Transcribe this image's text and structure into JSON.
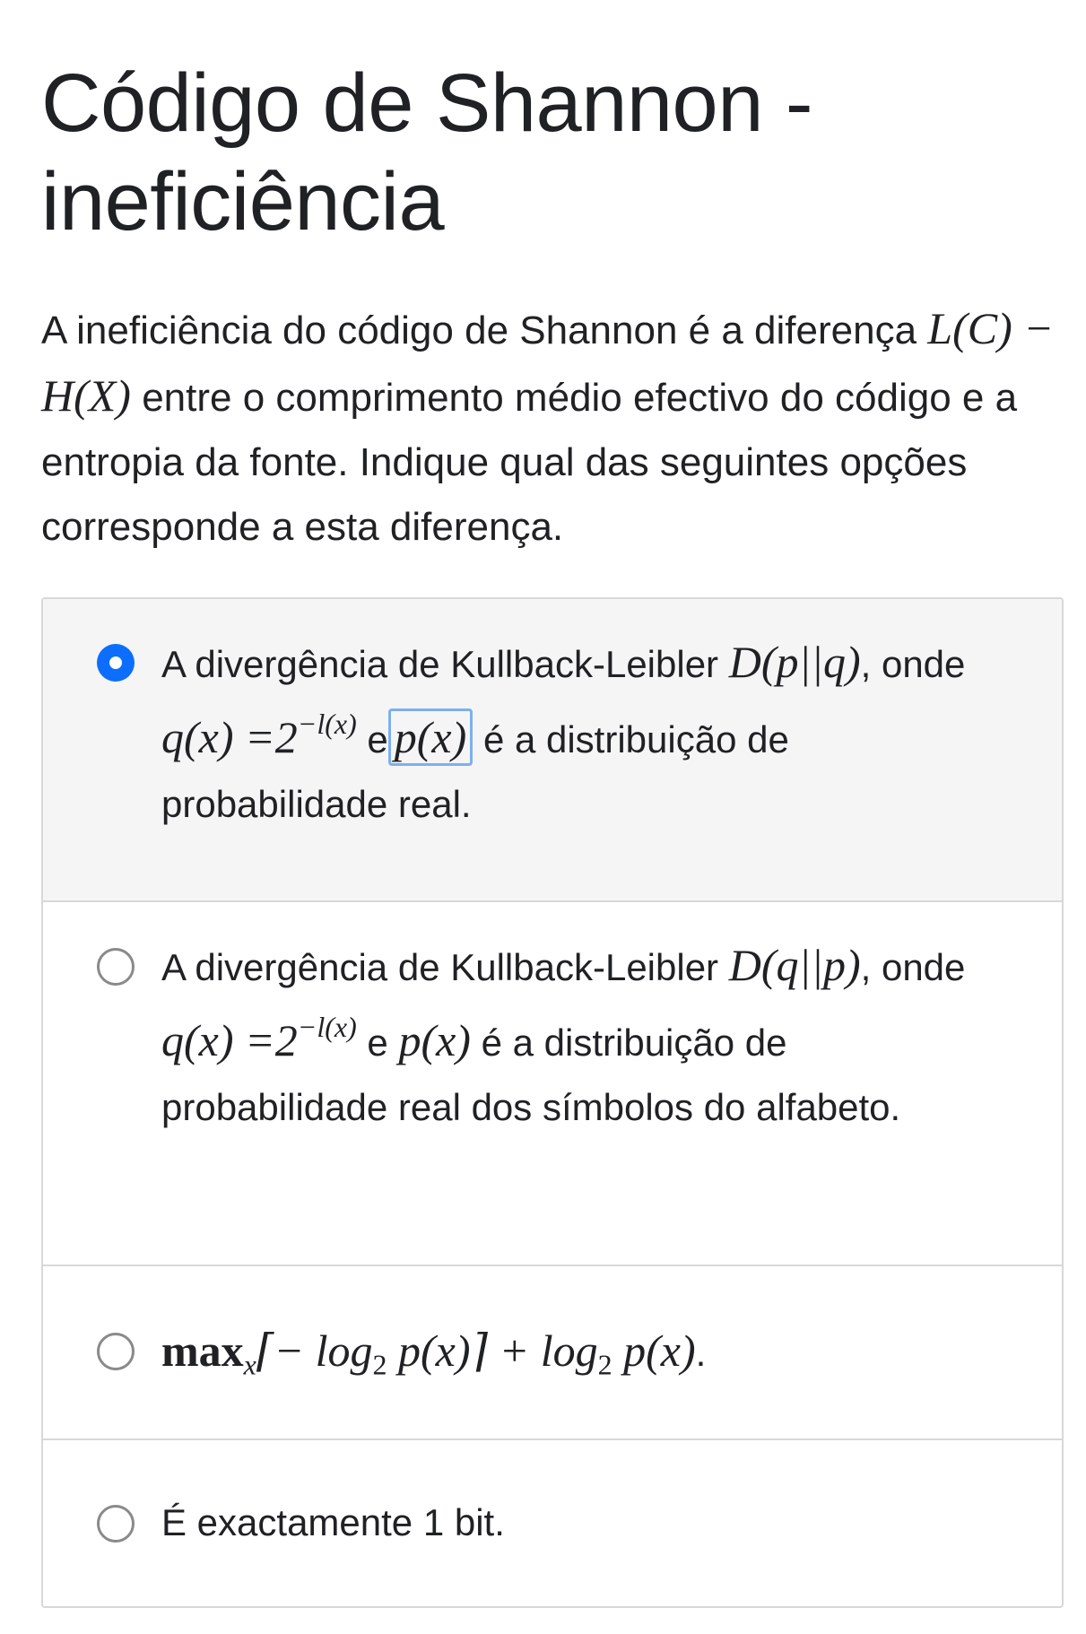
{
  "title": "Código de Shannon - ineficiência",
  "question": {
    "text_before": "A ineficiência do código de Shannon é a diferença",
    "math": "L(C) − H(X)",
    "text_after": "entre o comprimento médio efectivo do código e a entropia da fonte. Indique qual das seguintes opções corresponde a esta diferença."
  },
  "options": [
    {
      "selected": true,
      "text_a": "A divergência de Kullback-Leibler",
      "math_a": "D(p||q)",
      "text_b": ", onde",
      "math_b": "q(x) =2",
      "math_b_sup": "−l(x)",
      "text_c": "e",
      "math_c": "p(x)",
      "text_d": "é a distribuição de probabilidade real."
    },
    {
      "selected": false,
      "text_a": "A divergência de Kullback-Leibler",
      "math_a": "D(q||p)",
      "text_b": ", onde",
      "math_b": "q(x) =2",
      "math_b_sup": "−l(x)",
      "text_c": "e",
      "math_c": "p(x)",
      "text_d": "é a distribuição de probabilidade real dos símbolos do alfabeto."
    },
    {
      "selected": false,
      "math_max": "max",
      "math_max_sub": "x",
      "math_rest1": "⌈− log",
      "math_sub2": "2",
      "math_rest2": " p(x)⌉ + log",
      "math_sub3": "2",
      "math_rest3": " p(x)",
      "text_end": "."
    },
    {
      "selected": false,
      "text": "É exactamente 1 bit."
    }
  ],
  "colors": {
    "accent": "#0d6efd",
    "highlight_border": "#7cb0f0",
    "selected_bg": "#f5f5f5",
    "border": "#d8d8d8"
  }
}
